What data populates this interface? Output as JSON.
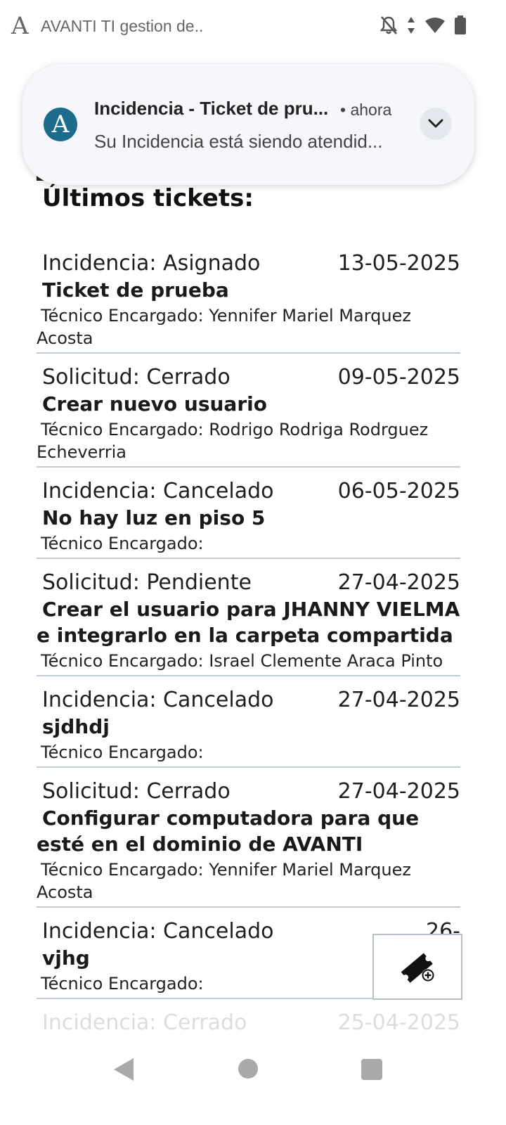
{
  "status_bar": {
    "app_logo": "A",
    "title": "AVANTI TI gestion de..",
    "icons": [
      "bell-off-icon",
      "data-arrows-icon",
      "wifi-icon",
      "battery-icon"
    ]
  },
  "notification": {
    "avatar_letter": "A",
    "title": "Incidencia - Ticket de pru...",
    "time": "• ahora",
    "body": "Su Incidencia está siendo atendid...",
    "accent": "#1d6c8c"
  },
  "page": {
    "heading": "Últimos tickets:"
  },
  "tickets": [
    {
      "status": "Incidencia: Asignado",
      "date": "13-05-2025",
      "title": "Ticket de prueba",
      "tech": "Técnico Encargado: Yennifer Mariel Marquez Acosta"
    },
    {
      "status": "Solicitud: Cerrado",
      "date": "09-05-2025",
      "title": "Crear nuevo usuario",
      "tech": "Técnico Encargado: Rodrigo Rodriga Rodrguez Echeverria"
    },
    {
      "status": "Incidencia: Cancelado",
      "date": "06-05-2025",
      "title": "No hay luz en piso 5",
      "tech": "Técnico Encargado:"
    },
    {
      "status": "Solicitud: Pendiente",
      "date": "27-04-2025",
      "title": "Crear el usuario para JHANNY VIELMA e integrarlo en la carpeta compartida",
      "tech": "Técnico Encargado: Israel Clemente Araca Pinto"
    },
    {
      "status": "Incidencia: Cancelado",
      "date": "27-04-2025",
      "title": "sjdhdj",
      "tech": "Técnico Encargado:"
    },
    {
      "status": "Solicitud: Cerrado",
      "date": "27-04-2025",
      "title": "Configurar computadora para que esté en el dominio de AVANTI",
      "tech": "Técnico Encargado: Yennifer Mariel Marquez Acosta"
    },
    {
      "status": "Incidencia: Cancelado",
      "date": "26-",
      "title": "vjhg",
      "tech": "Técnico Encargado:"
    },
    {
      "status": "Incidencia: Cerrado",
      "date": "25-04-2025",
      "title": "",
      "tech": ""
    }
  ],
  "fab": {
    "icon": "add-ticket-icon"
  },
  "nav_bar": {
    "icons": [
      "back-icon",
      "home-icon",
      "recents-icon"
    ]
  }
}
